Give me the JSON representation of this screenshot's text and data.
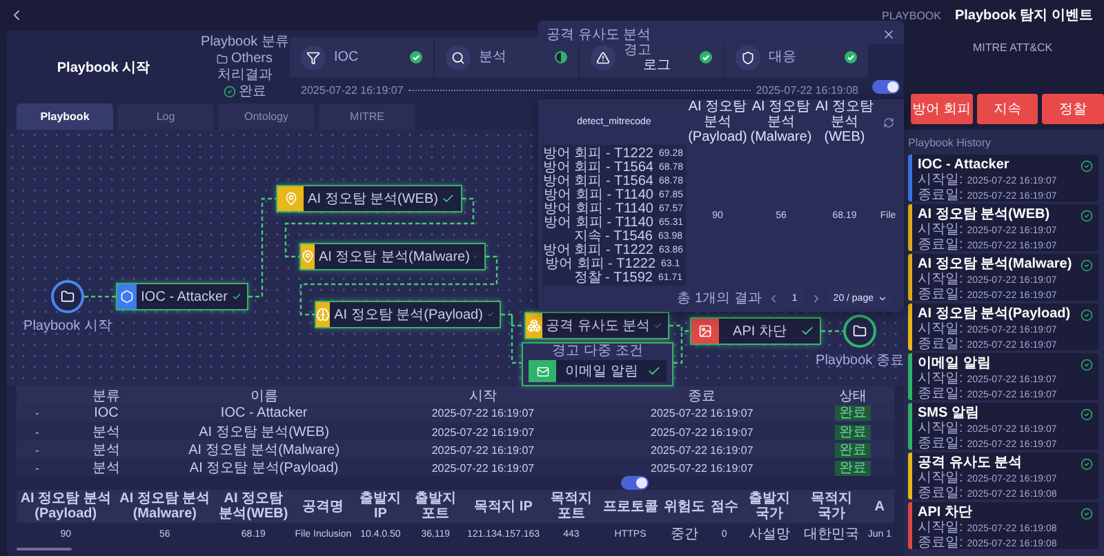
{
  "topbar": {
    "breadcrumb": [
      "PLAYBOOK",
      "Playbook 탐지 이벤트"
    ]
  },
  "summary": {
    "title": "Playbook 시작",
    "category_label": "Playbook 분류",
    "category": "Others",
    "result_label": "처리결과",
    "result": "완료"
  },
  "steps": [
    {
      "label": "IOC",
      "done": true
    },
    {
      "label": "분석",
      "done": false
    },
    {
      "label": "경고",
      "done": true,
      "note": "로그"
    },
    {
      "label": "대응",
      "done": true
    }
  ],
  "step_times": [
    "2025-07-22 16:19:07",
    "2025-07-22 16:19:08"
  ],
  "mitre": {
    "title": "MITRE ATT&CK",
    "tactics": [
      "방어 회피",
      "지속",
      "정찰"
    ]
  },
  "tabs": [
    {
      "label": "Playbook",
      "selected": true
    },
    {
      "label": "Log",
      "selected": false
    },
    {
      "label": "Ontology",
      "selected": false
    },
    {
      "label": "MITRE",
      "selected": false
    }
  ],
  "flow": {
    "nodes": [
      {
        "kind": "start",
        "label": "Playbook 시작",
        "color": "#4a86f0"
      },
      {
        "kind": "task",
        "label": "IOC - Attacker",
        "color": "#3d7bf0",
        "done": true
      },
      {
        "kind": "task",
        "label": "AI 정오탐 분석(WEB)",
        "color": "#e8b71a",
        "done": true
      },
      {
        "kind": "task",
        "label": "AI 정오탐 분석(Malware)",
        "color": "#e8b71a",
        "done": true
      },
      {
        "kind": "task",
        "label": "AI 정오탐 분석(Payload)",
        "color": "#e8b71a",
        "done": true
      },
      {
        "kind": "task",
        "label": "공격 유사도 분석",
        "color": "#e8b71a",
        "done": true
      },
      {
        "kind": "task",
        "label": "API 차단",
        "color": "#e04848",
        "done": true
      },
      {
        "kind": "end",
        "label": "Playbook 종료",
        "color": "#2fb36a"
      }
    ],
    "group": {
      "title": "경고 다중 조건",
      "items": [
        {
          "label": "이메일 알림",
          "color": "#2fb36a",
          "done": true
        }
      ]
    }
  },
  "steps_table": {
    "columns": [
      "분류",
      "이름",
      "시작",
      "종료",
      "상태"
    ],
    "rows": [
      {
        "marker": "-",
        "category": "IOC",
        "name": "IOC - Attacker",
        "start": "2025-07-22 16:19:07",
        "end": "2025-07-22 16:19:07",
        "status": "완료"
      },
      {
        "marker": "-",
        "category": "분석",
        "name": "AI 정오탐 분석(WEB)",
        "start": "2025-07-22 16:19:07",
        "end": "2025-07-22 16:19:07",
        "status": "완료"
      },
      {
        "marker": "-",
        "category": "분석",
        "name": "AI 정오탐 분석(Malware)",
        "start": "2025-07-22 16:19:07",
        "end": "2025-07-22 16:19:07",
        "status": "완료"
      },
      {
        "marker": "-",
        "category": "분석",
        "name": "AI 정오탐 분석(Payload)",
        "start": "2025-07-22 16:19:07",
        "end": "2025-07-22 16:19:07",
        "status": "완료"
      }
    ]
  },
  "log_toggle": {
    "on": true
  },
  "detail_toggle": {
    "on": true
  },
  "detail_table": {
    "columns": [
      "AI 정오탐 분석(Payload)",
      "AI 정오탐 분석(Malware)",
      "AI 정오탐 분석(WEB)",
      "공격명",
      "출발지 IP",
      "출발지 포트",
      "목적지 IP",
      "목적지 포트",
      "프로토콜",
      "위험도",
      "점수",
      "출발지 국가",
      "목적지 국가",
      "A"
    ],
    "rows": [
      [
        "90",
        "56",
        "68.19",
        "File Inclusion",
        "10.4.0.50",
        "36,119",
        "121.134.157.163",
        "443",
        "HTTPS",
        "중간",
        "0",
        "사설망",
        "대한민국",
        "Jun 1"
      ]
    ]
  },
  "similarity_modal": {
    "title": "공격 유사도 분석",
    "columns": [
      "detect_mitrecode",
      "AI 정오탐 분석(Payload)",
      "AI 정오탐 분석(Malware)",
      "AI 정오탐 분석(WEB)"
    ],
    "matches": [
      {
        "name": "방어 회피 - T1222",
        "score": "69.28"
      },
      {
        "name": "방어 회피 - T1564",
        "score": "68.78"
      },
      {
        "name": "방어 회피 - T1564",
        "score": "68.78"
      },
      {
        "name": "방어 회피 - T1140",
        "score": "67.85"
      },
      {
        "name": "방어 회피 - T1140",
        "score": "67.57"
      },
      {
        "name": "방어 회피 - T1140",
        "score": "65.31"
      },
      {
        "name": "지속 - T1546",
        "score": "63.98"
      },
      {
        "name": "방어 회피 - T1222",
        "score": "63.86"
      },
      {
        "name": "방어 회피 - T1222",
        "score": "63.1"
      },
      {
        "name": "정찰 - T1592",
        "score": "61.71"
      }
    ],
    "cells": [
      "90",
      "56",
      "68.19",
      "File"
    ],
    "total": "총 1개의 결과",
    "page": "1",
    "page_size": "20 / page"
  },
  "history": {
    "title": "Playbook History",
    "items": [
      {
        "title": "IOC - Attacker",
        "color": "#3d7bf0",
        "start_label": "시작일:",
        "start": "2025-07-22 16:19:07",
        "end_label": "종료일:",
        "end": "2025-07-22 16:19:07",
        "done": true
      },
      {
        "title": "AI 정오탐 분석(WEB)",
        "color": "#e8b71a",
        "start_label": "시작일:",
        "start": "2025-07-22 16:19:07",
        "end_label": "종료일:",
        "end": "2025-07-22 16:19:07",
        "done": true
      },
      {
        "title": "AI 정오탐 분석(Malware)",
        "color": "#e8b71a",
        "start_label": "시작일:",
        "start": "2025-07-22 16:19:07",
        "end_label": "종료일:",
        "end": "2025-07-22 16:19:07",
        "done": true
      },
      {
        "title": "AI 정오탐 분석(Payload)",
        "color": "#e8b71a",
        "start_label": "시작일:",
        "start": "2025-07-22 16:19:07",
        "end_label": "종료일:",
        "end": "2025-07-22 16:19:07",
        "done": true
      },
      {
        "title": "이메일 알림",
        "color": "#2fb36a",
        "start_label": "시작일:",
        "start": "2025-07-22 16:19:07",
        "end_label": "종료일:",
        "end": "2025-07-22 16:19:07",
        "done": true
      },
      {
        "title": "SMS 알림",
        "color": "#2fb36a",
        "start_label": "시작일:",
        "start": "2025-07-22 16:19:07",
        "end_label": "종료일:",
        "end": "2025-07-22 16:19:07",
        "done": true
      },
      {
        "title": "공격 유사도 분석",
        "color": "#e8b71a",
        "start_label": "시작일:",
        "start": "2025-07-22 16:19:07",
        "end_label": "종료일:",
        "end": "2025-07-22 16:19:08",
        "done": true
      },
      {
        "title": "API 차단",
        "color": "#e04848",
        "start_label": "시작일:",
        "start": "2025-07-22 16:19:08",
        "end_label": "종료일:",
        "end": "2025-07-22 16:19:08",
        "done": true
      }
    ]
  }
}
